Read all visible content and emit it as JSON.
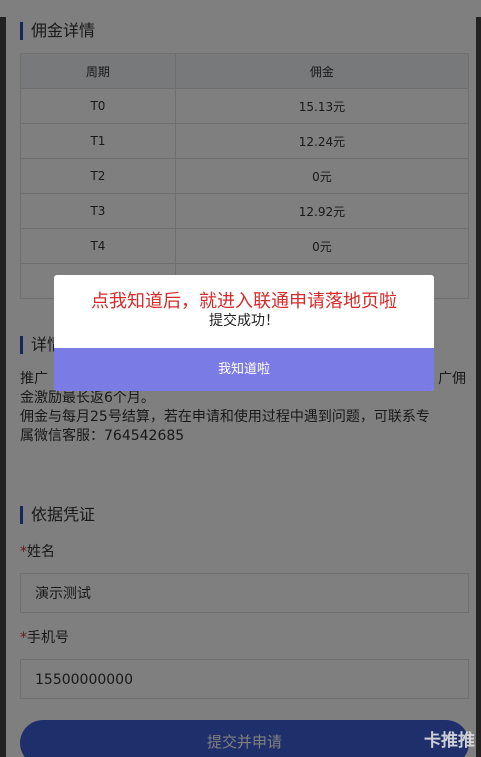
{
  "commission": {
    "title": "佣金详情",
    "headers": [
      "周期",
      "佣金"
    ],
    "rows": [
      {
        "period": "T0",
        "amount": "15.13元"
      },
      {
        "period": "T1",
        "amount": "12.24元"
      },
      {
        "period": "T2",
        "amount": "0元"
      },
      {
        "period": "T3",
        "amount": "12.92元"
      },
      {
        "period": "T4",
        "amount": "0元"
      },
      {
        "period": "",
        "amount": ""
      }
    ]
  },
  "details": {
    "title": "详情",
    "text_line1_start": "推广",
    "text_line1_end": "广佣",
    "text_line2": "金激励最长返6个月。",
    "text_line3": "佣金与每月25号结算，若在申请和使用过程中遇到问题，可联系专",
    "text_line4": "属微信客服：764542685"
  },
  "evidence": {
    "title": "依据凭证",
    "name_label": "姓名",
    "name_value": "演示测试",
    "phone_label": "手机号",
    "phone_value": "15500000000",
    "required_mark": "*"
  },
  "submit_label": "提交并申请",
  "modal": {
    "headline": "点我知道后，就进入联通申请落地页啦",
    "message": "提交成功！",
    "ok_label": "我知道啦"
  },
  "watermark": "卡推推"
}
